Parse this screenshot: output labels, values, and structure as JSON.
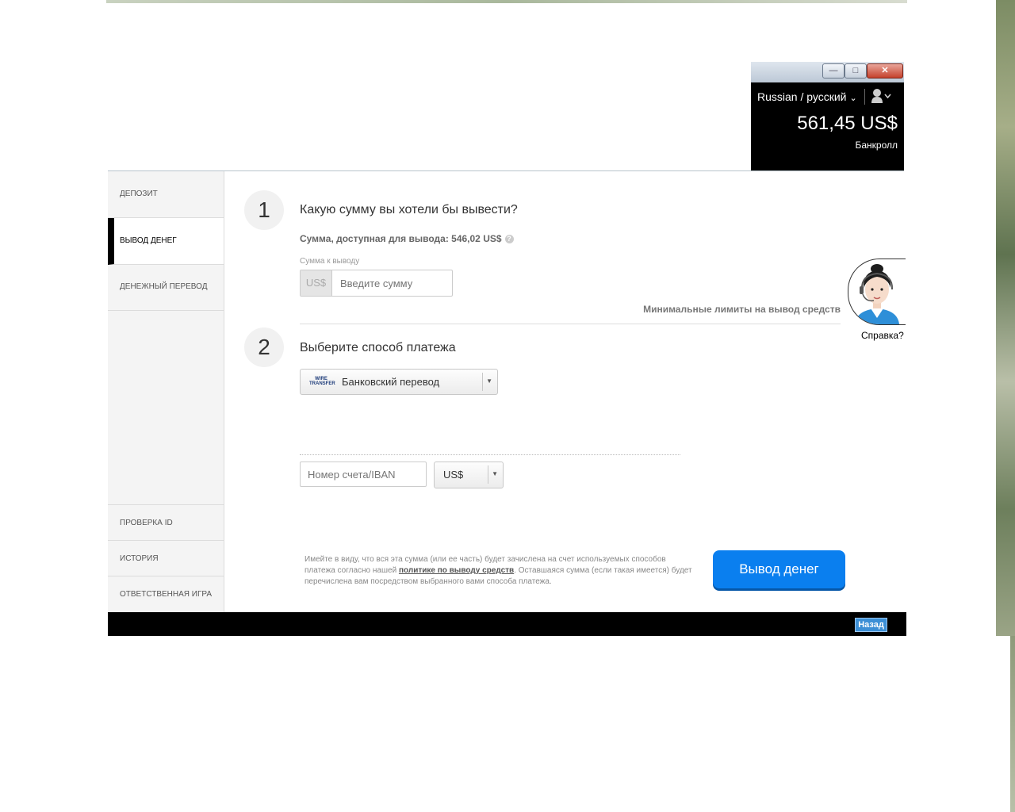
{
  "account": {
    "language": "Russian / русский",
    "balance": "561,45 US$",
    "bankroll_label": "Банкролл"
  },
  "window_controls": {
    "minimize": "—",
    "maximize": "□",
    "close": "✕"
  },
  "sidebar": {
    "items": [
      {
        "label": "ДЕПОЗИТ"
      },
      {
        "label": "ВЫВОД ДЕНЕГ",
        "active": true
      },
      {
        "label": "ДЕНЕЖНЫЙ ПЕРЕВОД"
      }
    ],
    "bottom_items": [
      {
        "label": "ПРОВЕРКА ID"
      },
      {
        "label": "ИСТОРИЯ"
      },
      {
        "label": "ОТВЕТСТВЕННАЯ ИГРА"
      }
    ]
  },
  "step1": {
    "number": "1",
    "title": "Какую сумму вы хотели бы вывести?",
    "available": "Сумма, доступная для вывода: 546,02 US$",
    "amount_label": "Сумма к выводу",
    "currency": "US$",
    "amount_placeholder": "Введите сумму",
    "min_limits": "Минимальные лимиты на вывод средств"
  },
  "step2": {
    "number": "2",
    "title": "Выберите способ платежа",
    "method_logo": "WIRE TRANSFER",
    "method": "Банковский перевод",
    "iban_placeholder": "Номер счета/IBAN",
    "currency": "US$"
  },
  "disclaimer": {
    "part1": "Имейте в виду, что вся эта сумма (или ее часть) будет зачислена на счет используемых способов платежа согласно нашей ",
    "link": "политике по выводу средств",
    "part2": ". Оставшаяся сумма (если такая имеется) будет перечислена вам посредством выбранного вами способа платежа."
  },
  "withdraw_button": "Вывод денег",
  "help_label": "Справка?",
  "back_button": "Назад",
  "colors": {
    "primary_button": "#0a7fef",
    "active_nav_bar": "#000000"
  }
}
